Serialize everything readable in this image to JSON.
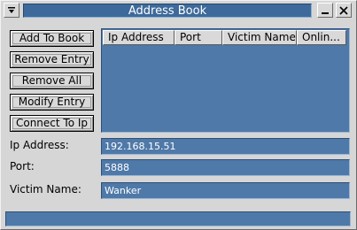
{
  "window": {
    "title": "Address Book",
    "icons": {
      "menu": "dropdown-menu-icon",
      "minimize": "minimize-icon",
      "close": "close-icon"
    }
  },
  "actions": [
    {
      "label": "Add To Book"
    },
    {
      "label": "Remove Entry"
    },
    {
      "label": "Remove All"
    },
    {
      "label": "Modify Entry"
    },
    {
      "label": "Connect To Ip"
    }
  ],
  "list": {
    "columns": [
      "Ip Address",
      "Port",
      "Victim Name",
      "Onlin..."
    ],
    "rows": []
  },
  "form": {
    "ip_label": "Ip Address:",
    "ip_value": "192.168.15.51",
    "port_label": "Port:",
    "port_value": "5888",
    "name_label": "Victim Name:",
    "name_value": "Wanker"
  },
  "statusbar": {
    "text": ""
  },
  "colors": {
    "accent": "#4f79a8",
    "title_bar": "#3d6a9a",
    "face": "#d6d6d6"
  }
}
